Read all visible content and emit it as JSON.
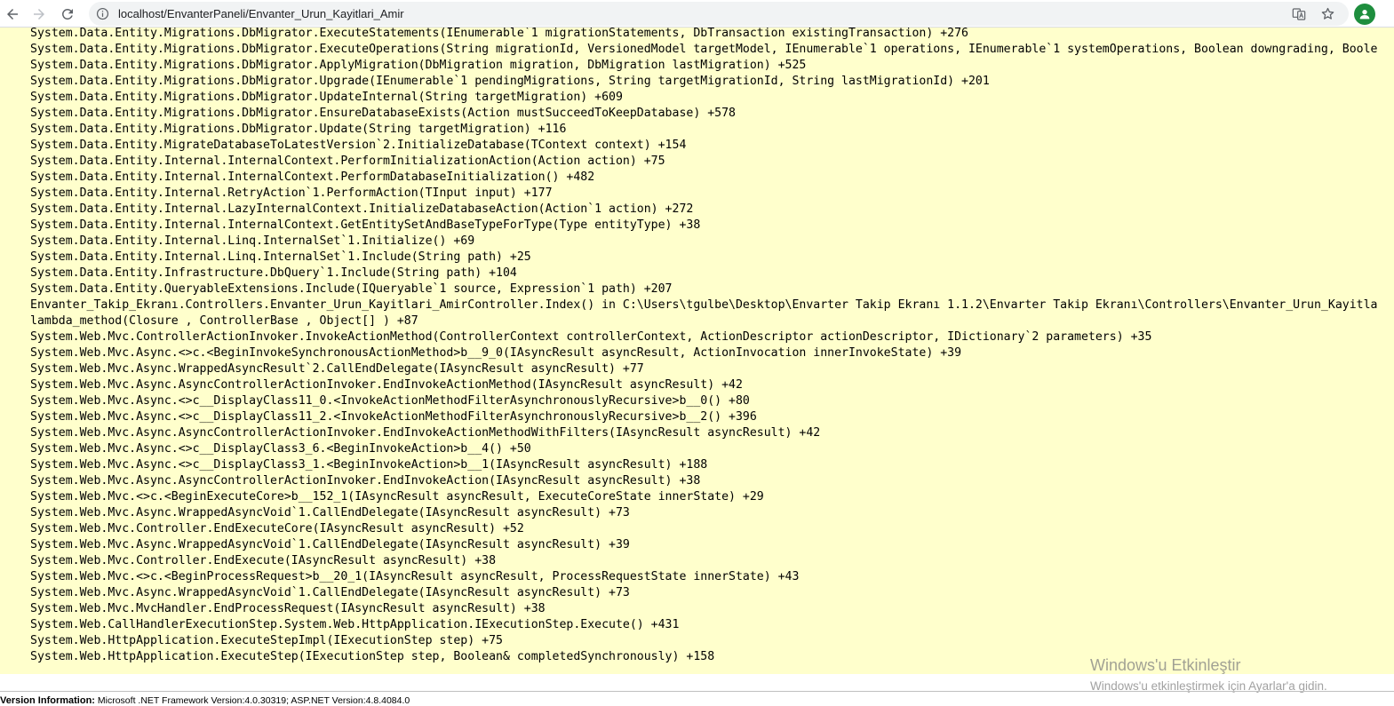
{
  "browser": {
    "url": "localhost/EnvanterPaneli/Envanter_Urun_Kayitlari_Amir",
    "icons": [
      "back-icon",
      "forward-icon",
      "reload-icon",
      "site-info-icon",
      "translate-icon",
      "bookmark-star-icon",
      "profile-avatar-icon"
    ],
    "avatar_color": "#1e8e3e"
  },
  "trace_background": "#ffffcc",
  "stack_trace": [
    "System.Data.Entity.Migrations.DbMigrator.ExecuteStatements(IEnumerable`1 migrationStatements, DbTransaction existingTransaction) +276",
    "System.Data.Entity.Migrations.DbMigrator.ExecuteOperations(String migrationId, VersionedModel targetModel, IEnumerable`1 operations, IEnumerable`1 systemOperations, Boolean downgrading, Boole",
    "System.Data.Entity.Migrations.DbMigrator.ApplyMigration(DbMigration migration, DbMigration lastMigration) +525",
    "System.Data.Entity.Migrations.DbMigrator.Upgrade(IEnumerable`1 pendingMigrations, String targetMigrationId, String lastMigrationId) +201",
    "System.Data.Entity.Migrations.DbMigrator.UpdateInternal(String targetMigration) +609",
    "System.Data.Entity.Migrations.DbMigrator.EnsureDatabaseExists(Action mustSucceedToKeepDatabase) +578",
    "System.Data.Entity.Migrations.DbMigrator.Update(String targetMigration) +116",
    "System.Data.Entity.MigrateDatabaseToLatestVersion`2.InitializeDatabase(TContext context) +154",
    "System.Data.Entity.Internal.InternalContext.PerformInitializationAction(Action action) +75",
    "System.Data.Entity.Internal.InternalContext.PerformDatabaseInitialization() +482",
    "System.Data.Entity.Internal.RetryAction`1.PerformAction(TInput input) +177",
    "System.Data.Entity.Internal.LazyInternalContext.InitializeDatabaseAction(Action`1 action) +272",
    "System.Data.Entity.Internal.InternalContext.GetEntitySetAndBaseTypeForType(Type entityType) +38",
    "System.Data.Entity.Internal.Linq.InternalSet`1.Initialize() +69",
    "System.Data.Entity.Internal.Linq.InternalSet`1.Include(String path) +25",
    "System.Data.Entity.Infrastructure.DbQuery`1.Include(String path) +104",
    "System.Data.Entity.QueryableExtensions.Include(IQueryable`1 source, Expression`1 path) +207",
    "Envanter_Takip_Ekranı.Controllers.Envanter_Urun_Kayitlari_AmirController.Index() in C:\\Users\\tgulbe\\Desktop\\Envarter Takip Ekranı 1.1.2\\Envarter Takip Ekranı\\Controllers\\Envanter_Urun_Kayitla",
    "lambda_method(Closure , ControllerBase , Object[] ) +87",
    "System.Web.Mvc.ControllerActionInvoker.InvokeActionMethod(ControllerContext controllerContext, ActionDescriptor actionDescriptor, IDictionary`2 parameters) +35",
    "System.Web.Mvc.Async.<>c.<BeginInvokeSynchronousActionMethod>b__9_0(IAsyncResult asyncResult, ActionInvocation innerInvokeState) +39",
    "System.Web.Mvc.Async.WrappedAsyncResult`2.CallEndDelegate(IAsyncResult asyncResult) +77",
    "System.Web.Mvc.Async.AsyncControllerActionInvoker.EndInvokeActionMethod(IAsyncResult asyncResult) +42",
    "System.Web.Mvc.Async.<>c__DisplayClass11_0.<InvokeActionMethodFilterAsynchronouslyRecursive>b__0() +80",
    "System.Web.Mvc.Async.<>c__DisplayClass11_2.<InvokeActionMethodFilterAsynchronouslyRecursive>b__2() +396",
    "System.Web.Mvc.Async.AsyncControllerActionInvoker.EndInvokeActionMethodWithFilters(IAsyncResult asyncResult) +42",
    "System.Web.Mvc.Async.<>c__DisplayClass3_6.<BeginInvokeAction>b__4() +50",
    "System.Web.Mvc.Async.<>c__DisplayClass3_1.<BeginInvokeAction>b__1(IAsyncResult asyncResult) +188",
    "System.Web.Mvc.Async.AsyncControllerActionInvoker.EndInvokeAction(IAsyncResult asyncResult) +38",
    "System.Web.Mvc.<>c.<BeginExecuteCore>b__152_1(IAsyncResult asyncResult, ExecuteCoreState innerState) +29",
    "System.Web.Mvc.Async.WrappedAsyncVoid`1.CallEndDelegate(IAsyncResult asyncResult) +73",
    "System.Web.Mvc.Controller.EndExecuteCore(IAsyncResult asyncResult) +52",
    "System.Web.Mvc.Async.WrappedAsyncVoid`1.CallEndDelegate(IAsyncResult asyncResult) +39",
    "System.Web.Mvc.Controller.EndExecute(IAsyncResult asyncResult) +38",
    "System.Web.Mvc.<>c.<BeginProcessRequest>b__20_1(IAsyncResult asyncResult, ProcessRequestState innerState) +43",
    "System.Web.Mvc.Async.WrappedAsyncVoid`1.CallEndDelegate(IAsyncResult asyncResult) +73",
    "System.Web.Mvc.MvcHandler.EndProcessRequest(IAsyncResult asyncResult) +38",
    "System.Web.CallHandlerExecutionStep.System.Web.HttpApplication.IExecutionStep.Execute() +431",
    "System.Web.HttpApplication.ExecuteStepImpl(IExecutionStep step) +75",
    "System.Web.HttpApplication.ExecuteStep(IExecutionStep step, Boolean& completedSynchronously) +158"
  ],
  "watermark": {
    "title": "Windows'u Etkinleştir",
    "subtitle": "Windows'u etkinleştirmek için Ayarlar'a gidin."
  },
  "version_info": {
    "label": "Version Information:",
    "text": "Microsoft .NET Framework Version:4.0.30319; ASP.NET Version:4.8.4084.0"
  }
}
